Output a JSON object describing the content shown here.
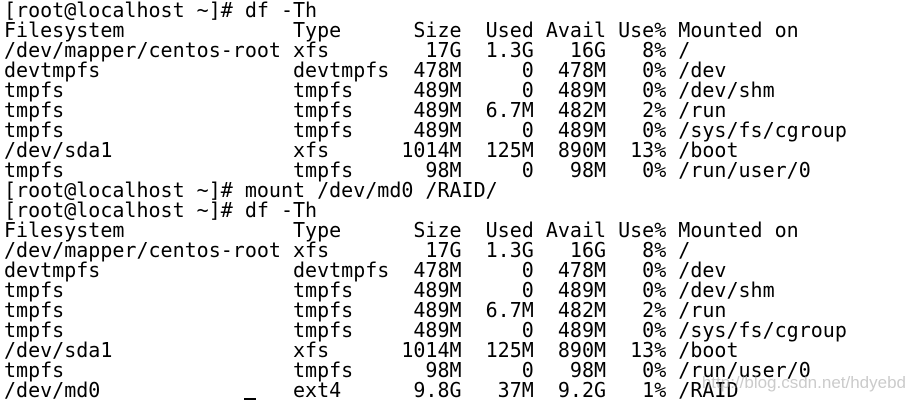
{
  "terminal": {
    "lines": [
      "[root@localhost ~]# df -Th",
      "Filesystem              Type      Size  Used Avail Use% Mounted on",
      "/dev/mapper/centos-root xfs        17G  1.3G   16G   8% /",
      "devtmpfs                devtmpfs  478M     0  478M   0% /dev",
      "tmpfs                   tmpfs     489M     0  489M   0% /dev/shm",
      "tmpfs                   tmpfs     489M  6.7M  482M   2% /run",
      "tmpfs                   tmpfs     489M     0  489M   0% /sys/fs/cgroup",
      "/dev/sda1               xfs      1014M  125M  890M  13% /boot",
      "tmpfs                   tmpfs      98M     0   98M   0% /run/user/0",
      "[root@localhost ~]# mount /dev/md0 /RAID/",
      "[root@localhost ~]# df -Th",
      "Filesystem              Type      Size  Used Avail Use% Mounted on",
      "/dev/mapper/centos-root xfs        17G  1.3G   16G   8% /",
      "devtmpfs                devtmpfs  478M     0  478M   0% /dev",
      "tmpfs                   tmpfs     489M     0  489M   0% /dev/shm",
      "tmpfs                   tmpfs     489M  6.7M  482M   2% /run",
      "tmpfs                   tmpfs     489M     0  489M   0% /sys/fs/cgroup",
      "/dev/sda1               xfs      1014M  125M  890M  13% /boot",
      "tmpfs                   tmpfs      98M     0   98M   0% /run/user/0",
      "/dev/md0                ext4      9.8G   37M  9.2G   1% /RAID"
    ],
    "watermark": "http://blog.csdn.net/hdyebd",
    "colors": {
      "background": "#ffffff",
      "text": "#000000"
    }
  }
}
